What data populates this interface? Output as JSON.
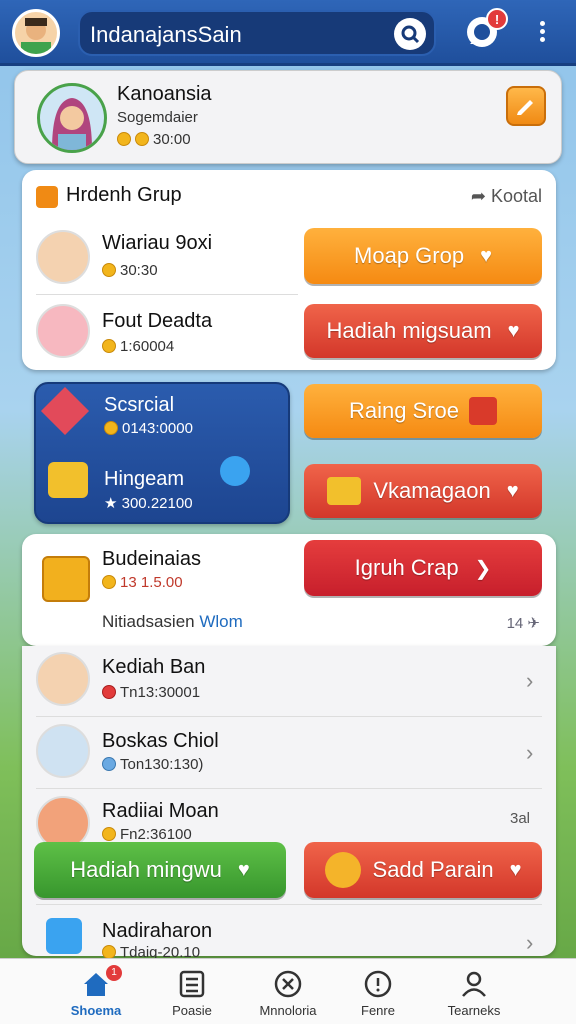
{
  "header": {
    "search_text": "IndanajansSain",
    "chat_badge": "!"
  },
  "profile": {
    "name": "Kanoansia",
    "subtitle": "Sogemdaier",
    "coins": "30:00"
  },
  "group_card": {
    "title": "Hrdenh Grup",
    "action_label": "Kootal",
    "members": [
      {
        "name": "Wiariau 9oxi",
        "stat": "30:30"
      },
      {
        "name": "Fout Deadta",
        "stat": "1:60004"
      }
    ],
    "buttons": [
      "Moap Grop",
      "Hadiah migsuam"
    ]
  },
  "special": {
    "title": "Scsrcial",
    "value": "0143:0000",
    "sub_title": "Hingeam",
    "sub_value": "300.22100"
  },
  "side_buttons": [
    "Raing Sroe",
    "Vkamagaon"
  ],
  "bundle": {
    "title": "Budeinaias",
    "price": "13 1.5.00",
    "note": "Nitiadsasien",
    "link": "Wlom",
    "button": "Igruh Crap",
    "count": "14"
  },
  "list": [
    {
      "name": "Kediah Ban",
      "stat": "Tn13:30001"
    },
    {
      "name": "Boskas Chiol",
      "stat": "Ton130:130)"
    },
    {
      "name": "Radiiai Moan",
      "stat": "Fn2:36100",
      "right": "3al"
    }
  ],
  "bottom_buttons": [
    "Hadiah mingwu",
    "Sadd Parain"
  ],
  "last_item": {
    "name": "Nadiraharon",
    "stat": "Tdaig-20.10"
  },
  "nav": [
    {
      "label": "Shoema",
      "badge": "1"
    },
    {
      "label": "Poasie"
    },
    {
      "label": "Mnnoloria"
    },
    {
      "label": "Fenre"
    },
    {
      "label": "Tearneks"
    }
  ],
  "colors": {
    "accent": "#1f4f9c",
    "orange": "#f58a12",
    "red": "#d3372a",
    "green": "#37962d"
  }
}
